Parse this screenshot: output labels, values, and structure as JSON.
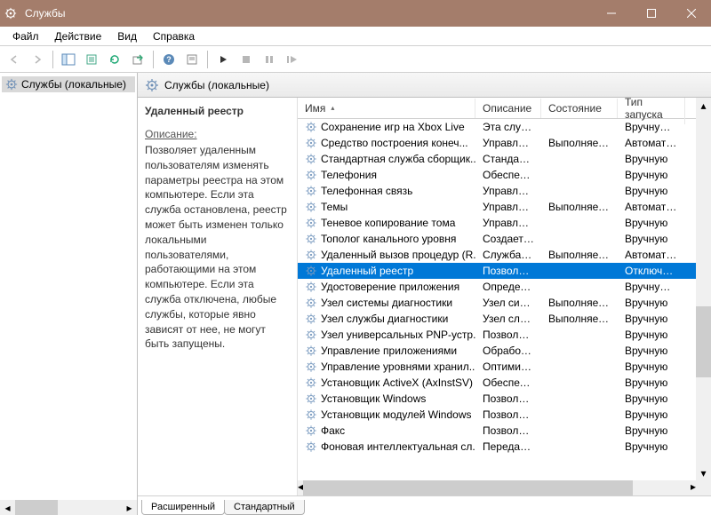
{
  "window": {
    "title": "Службы"
  },
  "menu": {
    "file": "Файл",
    "action": "Действие",
    "view": "Вид",
    "help": "Справка"
  },
  "tree": {
    "root": "Службы (локальные)"
  },
  "panel_title": "Службы (локальные)",
  "details": {
    "name": "Удаленный реестр",
    "desc_label": "Описание:",
    "desc_text": "Позволяет удаленным пользователям изменять параметры реестра на этом компьютере. Если эта служба остановлена, реестр может быть изменен только локальными пользователями, работающими на этом компьютере. Если эта служба отключена, любые службы, которые явно зависят от нее, не могут быть запущены."
  },
  "columns": {
    "name": "Имя",
    "desc": "Описание",
    "state": "Состояние",
    "start": "Тип запуска"
  },
  "rows": [
    {
      "name": "Сохранение игр на Xbox Live",
      "desc": "Эта служб...",
      "state": "",
      "start": "Вручную (ак",
      "sel": false
    },
    {
      "name": "Средство построения конеч...",
      "desc": "Управляе...",
      "state": "Выполняется",
      "start": "Автоматиче",
      "sel": false
    },
    {
      "name": "Стандартная служба сборщик...",
      "desc": "Стандартн...",
      "state": "",
      "start": "Вручную",
      "sel": false
    },
    {
      "name": "Телефония",
      "desc": "Обеспечи...",
      "state": "",
      "start": "Вручную",
      "sel": false
    },
    {
      "name": "Телефонная связь",
      "desc": "Управляе...",
      "state": "",
      "start": "Вручную",
      "sel": false
    },
    {
      "name": "Темы",
      "desc": "Управляе...",
      "state": "Выполняется",
      "start": "Автоматиче",
      "sel": false
    },
    {
      "name": "Теневое копирование тома",
      "desc": "Управляе...",
      "state": "",
      "start": "Вручную",
      "sel": false
    },
    {
      "name": "Тополог канального уровня",
      "desc": "Создает ка...",
      "state": "",
      "start": "Вручную",
      "sel": false
    },
    {
      "name": "Удаленный вызов процедур (R...",
      "desc": "Служба R...",
      "state": "Выполняется",
      "start": "Автоматиче",
      "sel": false
    },
    {
      "name": "Удаленный реестр",
      "desc": "Позволяет...",
      "state": "",
      "start": "Отключена",
      "sel": true
    },
    {
      "name": "Удостоверение приложения",
      "desc": "Определя...",
      "state": "",
      "start": "Вручную (ак",
      "sel": false
    },
    {
      "name": "Узел системы диагностики",
      "desc": "Узел систе...",
      "state": "Выполняется",
      "start": "Вручную",
      "sel": false
    },
    {
      "name": "Узел службы диагностики",
      "desc": "Узел служ...",
      "state": "Выполняется",
      "start": "Вручную",
      "sel": false
    },
    {
      "name": "Узел универсальных PNP-устр...",
      "desc": "Позволяет...",
      "state": "",
      "start": "Вручную",
      "sel": false
    },
    {
      "name": "Управление приложениями",
      "desc": "Обработк...",
      "state": "",
      "start": "Вручную",
      "sel": false
    },
    {
      "name": "Управление уровнями хранил...",
      "desc": "Оптимизи...",
      "state": "",
      "start": "Вручную",
      "sel": false
    },
    {
      "name": "Установщик ActiveX (AxInstSV)",
      "desc": "Обеспечи...",
      "state": "",
      "start": "Вручную",
      "sel": false
    },
    {
      "name": "Установщик Windows",
      "desc": "Позволяет...",
      "state": "",
      "start": "Вручную",
      "sel": false
    },
    {
      "name": "Установщик модулей Windows",
      "desc": "Позволяет...",
      "state": "",
      "start": "Вручную",
      "sel": false
    },
    {
      "name": "Факс",
      "desc": "Позволяет...",
      "state": "",
      "start": "Вручную",
      "sel": false
    },
    {
      "name": "Фоновая интеллектуальная сл...",
      "desc": "Передает...",
      "state": "",
      "start": "Вручную",
      "sel": false
    }
  ],
  "tabs": {
    "extended": "Расширенный",
    "standard": "Стандартный"
  }
}
